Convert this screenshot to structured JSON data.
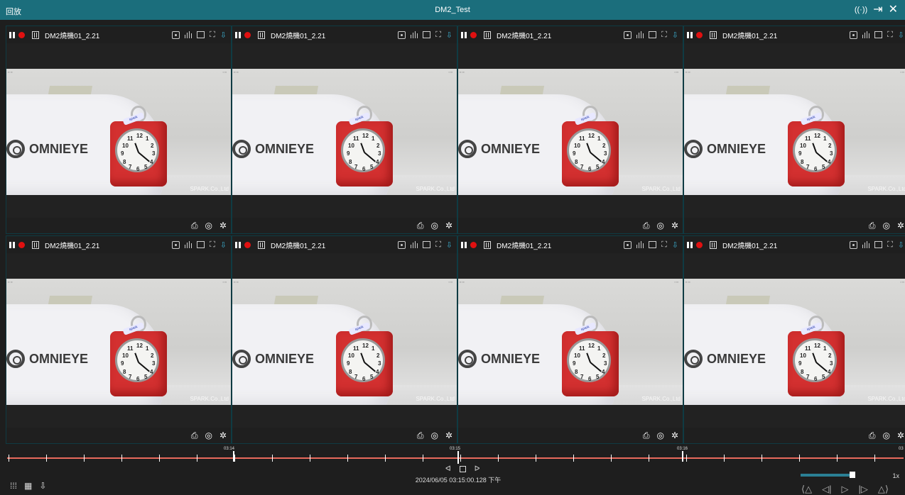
{
  "window": {
    "left_title": "回放",
    "center_title": "DM2_Test",
    "icons": [
      "broadcast-icon",
      "exit-icon",
      "close-icon"
    ],
    "broadcast_glyph": "((·))",
    "exit_glyph": "⇥",
    "close_glyph": "✕"
  },
  "panes": [
    {
      "camera": "DM2燒機01_2.21",
      "watermark": "SPARK.Co.,Ltd"
    },
    {
      "camera": "DM2燒機01_2.21",
      "watermark": "SPARK.Co.,Ltd"
    },
    {
      "camera": "DM2燒機01_2.21",
      "watermark": "SPARK.Co.,Ltd"
    },
    {
      "camera": "DM2燒機01_2.21",
      "watermark": "SPARK.Co.,Ltd"
    },
    {
      "camera": "DM2燒機01_2.21",
      "watermark": "SPARK.Co.,Ltd"
    },
    {
      "camera": "DM2燒機01_2.21",
      "watermark": "SPARK.Co.,Ltd"
    },
    {
      "camera": "DM2燒機01_2.21",
      "watermark": "SPARK.Co.,Ltd"
    },
    {
      "camera": "DM2燒機01_2.21",
      "watermark": "SPARK.Co.,Ltd"
    }
  ],
  "video": {
    "logo_text": "OMNIEYE",
    "clock_label": "spark",
    "clock_numbers": [
      "12",
      "1",
      "2",
      "3",
      "4",
      "5",
      "6",
      "7",
      "8",
      "9",
      "10",
      "11"
    ]
  },
  "pane_footer_glyphs": {
    "print": "⎙",
    "snapshot": "◎",
    "settings": "✲"
  },
  "pane_header_glyphs": {
    "expand": "⛶",
    "pin": "⇩"
  },
  "timeline": {
    "labels": [
      "03:14",
      "03:15",
      "03:16",
      "03"
    ],
    "current_datetime": "2024/06/05 03:15:00.128 下午",
    "prev_glyph": "ᐊ",
    "next_glyph": "ᐅ"
  },
  "bottom_left_icons": {
    "grid": "⁞⁞⁞",
    "calendar": "▦",
    "export": "⇩"
  },
  "speed": {
    "value_fraction": 0.68,
    "label": "1x"
  },
  "playback_controls": {
    "slower": "⟨△",
    "step_back": "◁|",
    "play": "▷",
    "step_forward": "|▷",
    "faster": "△⟩"
  },
  "colors": {
    "titlebar": "#1b6e7c",
    "timeline_line": "#e86a5c",
    "record_dot": "#e01010",
    "speed_fill": "#2a7f94"
  }
}
